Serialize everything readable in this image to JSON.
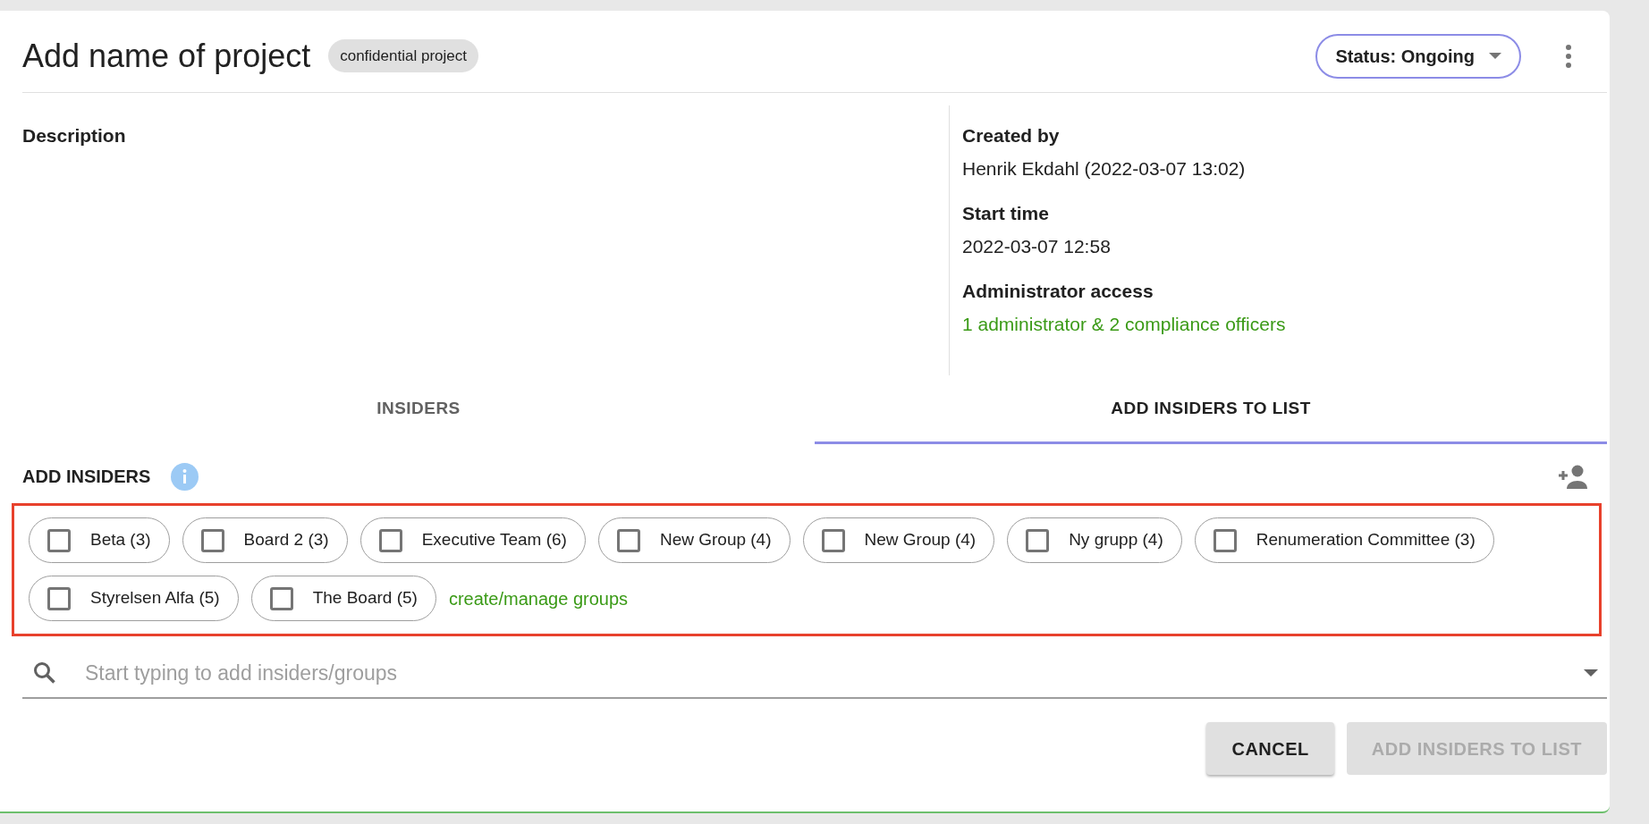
{
  "header": {
    "title": "Add name of project",
    "tag": "confidential project",
    "status": "Status: Ongoing"
  },
  "description": {
    "label": "Description"
  },
  "details": [
    {
      "label": "Created by",
      "value": "Henrik Ekdahl (2022-03-07 13:02)",
      "kind": "text"
    },
    {
      "label": "Start time",
      "value": "2022-03-07 12:58",
      "kind": "text"
    },
    {
      "label": "Administrator access",
      "value": "1 administrator & 2 compliance officers",
      "kind": "link"
    }
  ],
  "tabs": [
    {
      "label": "INSIDERS",
      "selected": false
    },
    {
      "label": "ADD INSIDERS TO LIST",
      "selected": true
    }
  ],
  "add_insiders": {
    "label": "ADD INSIDERS",
    "groups": [
      {
        "label": "Beta (3)",
        "checked": false
      },
      {
        "label": "Board 2 (3)",
        "checked": false
      },
      {
        "label": "Executive Team (6)",
        "checked": false
      },
      {
        "label": "New Group (4)",
        "checked": false
      },
      {
        "label": "New Group (4)",
        "checked": false
      },
      {
        "label": "Ny grupp (4)",
        "checked": false
      },
      {
        "label": "Renumeration Committee (3)",
        "checked": false
      },
      {
        "label": "Styrelsen Alfa (5)",
        "checked": false
      },
      {
        "label": "The Board (5)",
        "checked": false
      }
    ],
    "manage_link": "create/manage groups"
  },
  "search": {
    "placeholder": "Start typing to add insiders/groups"
  },
  "buttons": [
    {
      "label": "CANCEL",
      "disabled": false
    },
    {
      "label": "ADD INSIDERS TO LIST",
      "disabled": true
    }
  ]
}
